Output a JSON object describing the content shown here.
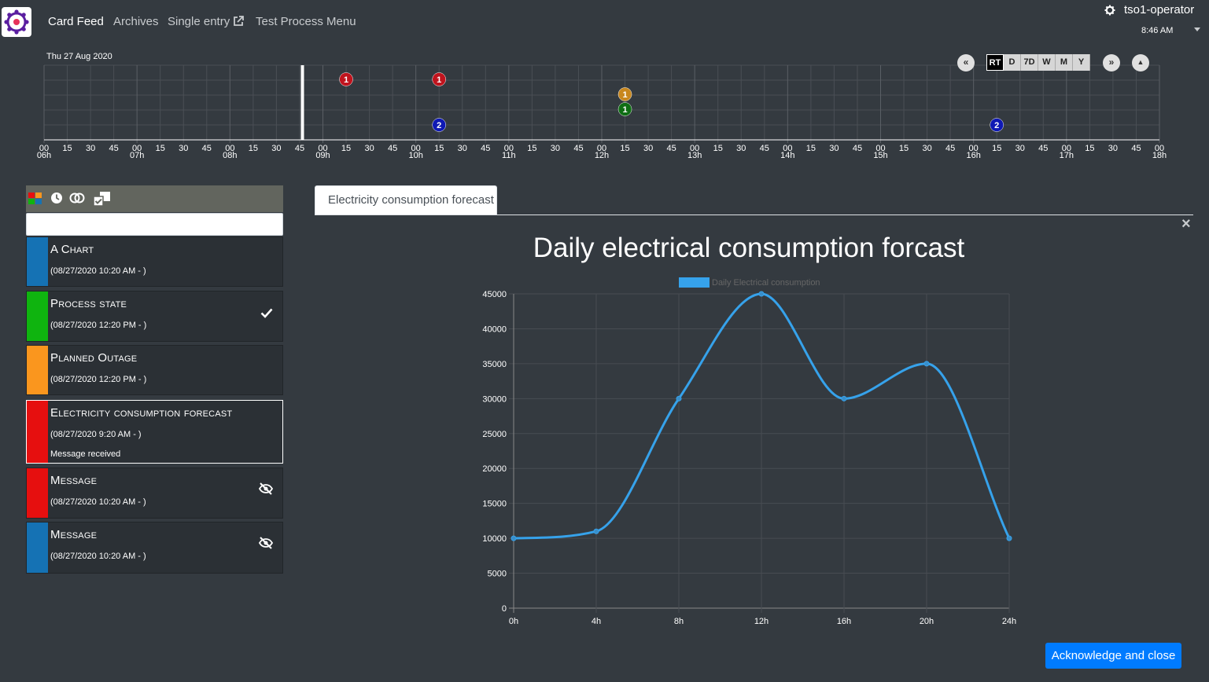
{
  "nav": {
    "links": [
      {
        "label": "Card Feed",
        "active": true
      },
      {
        "label": "Archives",
        "active": false
      },
      {
        "label": "Single entry",
        "active": false
      },
      {
        "label": "Test Process Menu",
        "active": false
      }
    ],
    "user": "tso1-operator",
    "time": "8:46 AM"
  },
  "timeline": {
    "date": "Thu 27 Aug 2020",
    "hours": [
      "06h",
      "07h",
      "08h",
      "09h",
      "10h",
      "11h",
      "12h",
      "13h",
      "14h",
      "15h",
      "16h",
      "17h",
      "18h"
    ],
    "minute_labels": [
      "00",
      "15",
      "30",
      "45"
    ],
    "current_time_hour": 8.78,
    "zoom_buttons": [
      "RT",
      "D",
      "7D",
      "W",
      "M",
      "Y"
    ],
    "active_zoom": "RT",
    "nav_prev": "«",
    "nav_next": "»",
    "nav_collapse": "▲",
    "bubbles": [
      {
        "time_hour": 9.25,
        "row": 0,
        "count": "1",
        "color": "#c0141e"
      },
      {
        "time_hour": 10.25,
        "row": 0,
        "count": "1",
        "color": "#c0141e"
      },
      {
        "time_hour": 12.25,
        "row": 1,
        "count": "1",
        "color": "#c8871e"
      },
      {
        "time_hour": 12.25,
        "row": 2,
        "count": "1",
        "color": "#0f6e14"
      },
      {
        "time_hour": 10.25,
        "row": 3,
        "count": "2",
        "color": "#0f19b4"
      },
      {
        "time_hour": 16.25,
        "row": 3,
        "count": "2",
        "color": "#0f19b4"
      }
    ]
  },
  "search": {
    "placeholder": "",
    "value": ""
  },
  "cards": [
    {
      "title": "A Chart",
      "date": "(08/27/2020 10:20 AM - )",
      "color": "#1572b4",
      "icon": ""
    },
    {
      "title": "Process state",
      "date": "(08/27/2020 12:20 PM - )",
      "color": "#0fb40f",
      "icon": "check-icon"
    },
    {
      "title": "Planned Outage",
      "date": "(08/27/2020 12:20 PM - )",
      "color": "#fa961e",
      "icon": ""
    },
    {
      "title": "Electricity consumption forecast",
      "date": "(08/27/2020 9:20 AM - )",
      "color": "#e60f0f",
      "message": "Message received",
      "icon": "",
      "selected": true
    },
    {
      "title": "Message",
      "date": "(08/27/2020 10:20 AM - )",
      "color": "#e60f0f",
      "icon": "eye-slash-icon"
    },
    {
      "title": "Message",
      "date": "(08/27/2020 10:20 AM - )",
      "color": "#1572b4",
      "icon": "eye-slash-icon"
    }
  ],
  "detail": {
    "tab": "Electricity consumption forecast",
    "close": "×",
    "ack_label": "Acknowledge and close"
  },
  "chart_data": {
    "type": "line",
    "title": "Daily electrical consumption forcast",
    "series": [
      {
        "name": "Daily Electrical consumption",
        "values": [
          10000,
          11000,
          30000,
          45000,
          30000,
          35000,
          10000
        ],
        "color": "#36a2eb"
      }
    ],
    "categories": [
      "0h",
      "4h",
      "8h",
      "12h",
      "16h",
      "20h",
      "24h"
    ],
    "ylim": [
      0,
      45000
    ],
    "yticks": [
      0,
      5000,
      10000,
      15000,
      20000,
      25000,
      30000,
      35000,
      40000,
      45000
    ],
    "grid": true,
    "legend": "top"
  }
}
